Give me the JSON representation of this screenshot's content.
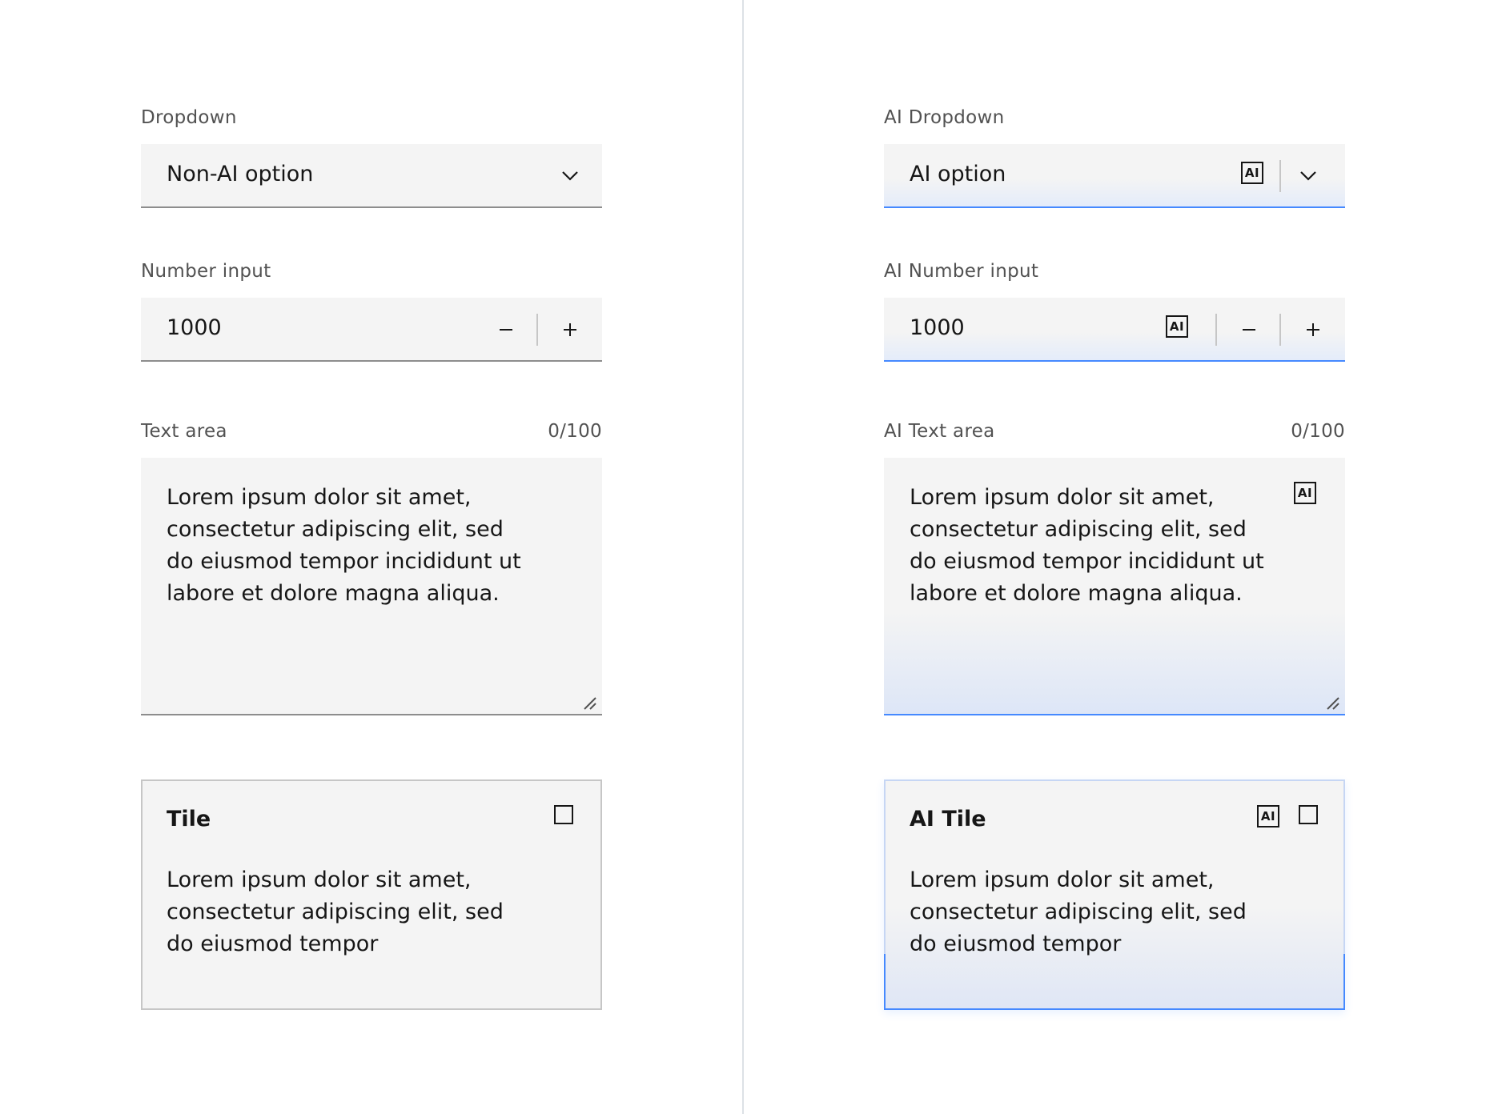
{
  "non_ai": {
    "dropdown": {
      "label": "Dropdown",
      "value": "Non-AI option",
      "icon": "chevron-down-icon"
    },
    "number_input": {
      "label": "Number input",
      "value": "1000",
      "decrement_icon": "minus-icon",
      "increment_icon": "plus-icon"
    },
    "text_area": {
      "label": "Text area",
      "counter": "0/100",
      "value": "Lorem ipsum dolor sit amet, consectetur adipiscing elit, sed do eiusmod tempor incididunt ut labore et dolore magna aliqua."
    },
    "tile": {
      "title": "Tile",
      "body": "Lorem ipsum dolor sit amet, consectetur adipiscing elit, sed do eiusmod tempor"
    }
  },
  "ai": {
    "badge_text": "AI",
    "dropdown": {
      "label": "AI Dropdown",
      "value": "AI option",
      "icon": "chevron-down-icon"
    },
    "number_input": {
      "label": "AI Number input",
      "value": "1000",
      "decrement_icon": "minus-icon",
      "increment_icon": "plus-icon"
    },
    "text_area": {
      "label": "AI Text area",
      "counter": "0/100",
      "value": "Lorem ipsum dolor sit amet, consectetur adipiscing elit, sed do eiusmod tempor incididunt ut labore et dolore magna aliqua."
    },
    "tile": {
      "title": "AI Tile",
      "body": "Lorem ipsum dolor sit amet, consectetur adipiscing elit, sed do eiusmod tempor"
    }
  },
  "colors": {
    "field_background": "#f4f4f4",
    "field_border": "#8d8d8d",
    "ai_accent": "#4589ff",
    "ai_gradient_end": "#e4ecfa",
    "text_primary": "#161616",
    "text_secondary": "#525252"
  }
}
